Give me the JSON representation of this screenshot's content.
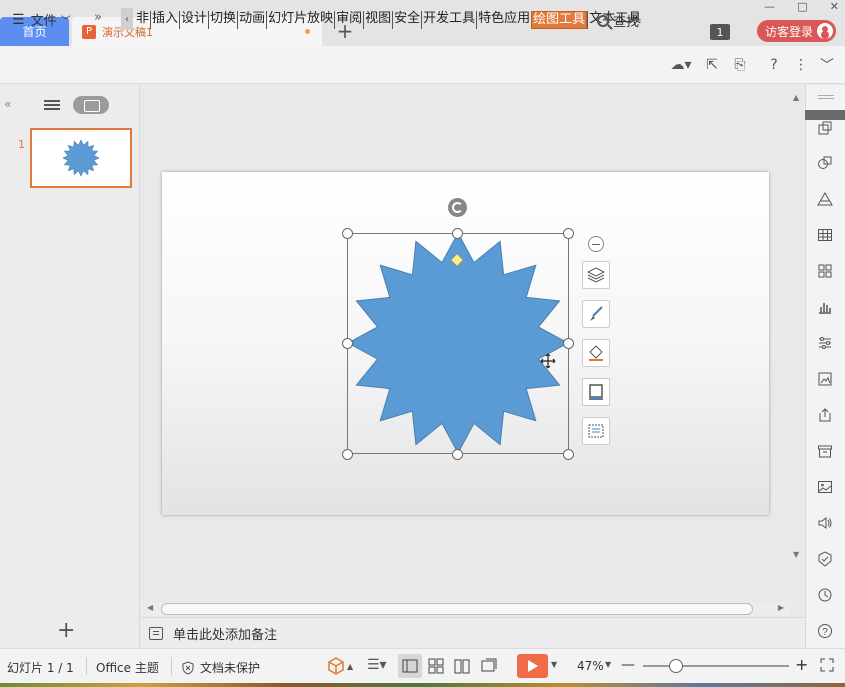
{
  "titlebar": {
    "home_tab": "首页",
    "doc_tab": "演示文稿1",
    "doc_icon": "P",
    "tab_count": "1",
    "guest_login": "访客登录",
    "win_min": "—",
    "win_max": "□",
    "win_close": "✕"
  },
  "menubar": {
    "file": "文件",
    "more": "»",
    "scroll_left": "‹",
    "tabs": [
      "开始",
      "插入",
      "设计",
      "切换",
      "动画",
      "幻灯片放映",
      "审阅",
      "视图",
      "安全",
      "开发工具",
      "特色应用",
      "绘图工具",
      "文本工具"
    ],
    "tab_first_partial": "非",
    "active_tab": "绘图工具",
    "find": "查找"
  },
  "left_panel": {
    "collapse": "«",
    "thumb_number": "1",
    "add": "+"
  },
  "notes": {
    "placeholder": "单击此处添加备注"
  },
  "statusbar": {
    "slide_info": "幻灯片 1 / 1",
    "theme": "Office 主题",
    "protection": "文档未保护",
    "zoom": "47%",
    "zoom_minus": "—",
    "zoom_plus": "+"
  },
  "shape": {
    "type": "16-point star",
    "fill": "#5b9bd5",
    "stroke": "#4a7fb0"
  },
  "colors": {
    "accent": "#e07a3a",
    "home_tab": "#5b8ef0",
    "guest_login": "#d95757",
    "play": "#f06b4a"
  }
}
